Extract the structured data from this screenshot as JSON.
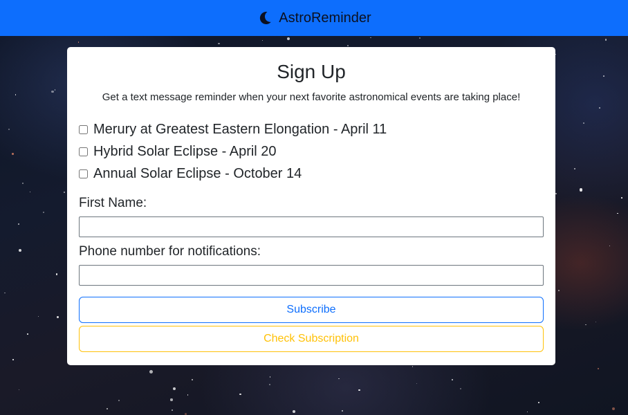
{
  "navbar": {
    "brand_text": "AstroReminder",
    "brand_icon": "moon-icon",
    "background_color": "#0d6efd"
  },
  "card": {
    "title": "Sign Up",
    "subtitle": "Get a text message reminder when your next favorite astronomical events are taking place!",
    "events": [
      {
        "label": "Merury at Greatest Eastern Elongation - April 11",
        "checked": false
      },
      {
        "label": "Hybrid Solar Eclipse - April 20",
        "checked": false
      },
      {
        "label": "Annual Solar Eclipse - October 14",
        "checked": false
      }
    ],
    "first_name": {
      "label": "First Name:",
      "value": "",
      "placeholder": ""
    },
    "phone": {
      "label": "Phone number for notifications:",
      "value": "",
      "placeholder": ""
    },
    "subscribe_label": "Subscribe",
    "check_subscription_label": "Check Subscription"
  },
  "colors": {
    "primary": "#0d6efd",
    "warning": "#ffc107"
  }
}
